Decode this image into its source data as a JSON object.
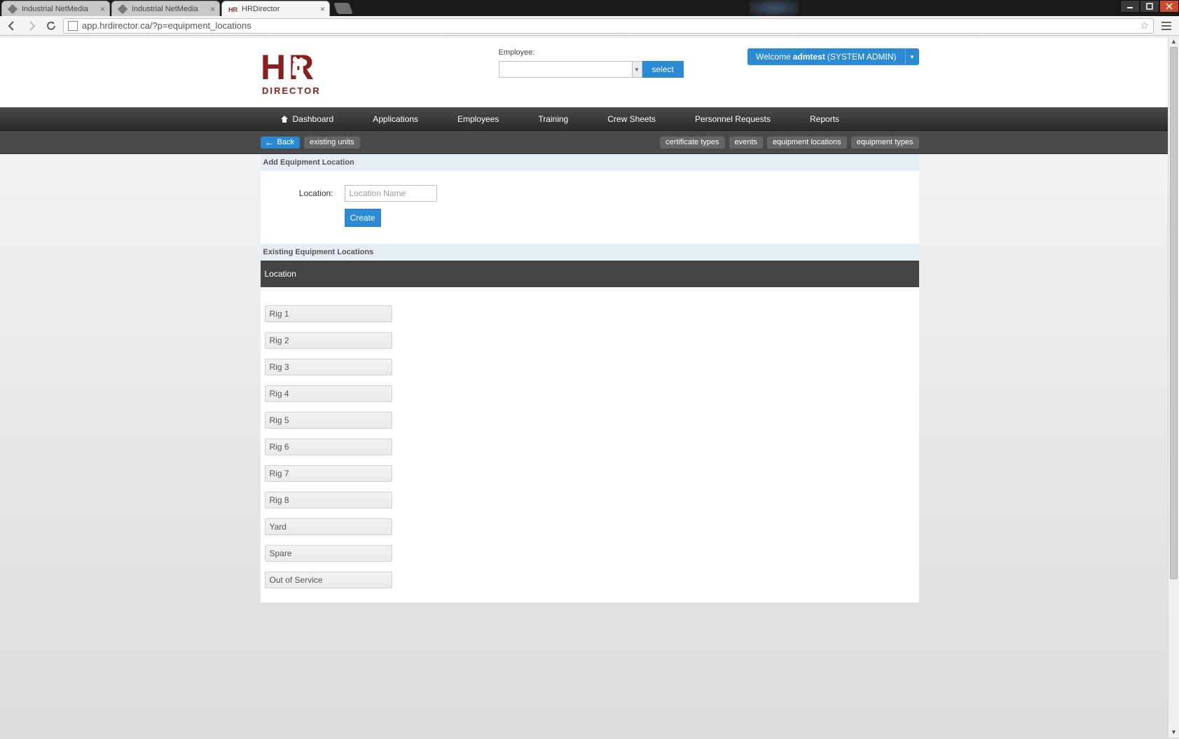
{
  "browser": {
    "tabs": [
      {
        "title": "Industrial NetMedia",
        "active": false
      },
      {
        "title": "Industrial NetMedia",
        "active": false
      },
      {
        "title": "HRDirector",
        "active": true
      }
    ],
    "url": "app.hrdirector.ca/?p=equipment_locations"
  },
  "header": {
    "logo_top": "HR",
    "logo_bottom": "DIRECTOR",
    "employee_label": "Employee:",
    "employee_value": "",
    "select_button": "select",
    "welcome_prefix": "Welcome ",
    "welcome_user": "admtest",
    "welcome_suffix": " (SYSTEM ADMIN)"
  },
  "nav": {
    "items": [
      "Dashboard",
      "Applications",
      "Employees",
      "Training",
      "Crew Sheets",
      "Personnel Requests",
      "Reports"
    ]
  },
  "subnav": {
    "back": "Back",
    "left": [
      "existing units"
    ],
    "right": [
      "certificate types",
      "events",
      "equipment locations",
      "equipment types"
    ]
  },
  "form": {
    "section_title": "Add Equipment Location",
    "location_label": "Location:",
    "location_placeholder": "Location Name",
    "create_button": "Create"
  },
  "list": {
    "section_title": "Existing Equipment Locations",
    "column": "Location",
    "items": [
      "Rig 1",
      "Rig 2",
      "Rig 3",
      "Rig 4",
      "Rig 5",
      "Rig 6",
      "Rig 7",
      "Rig 8",
      "Yard",
      "Spare",
      "Out of Service"
    ]
  }
}
